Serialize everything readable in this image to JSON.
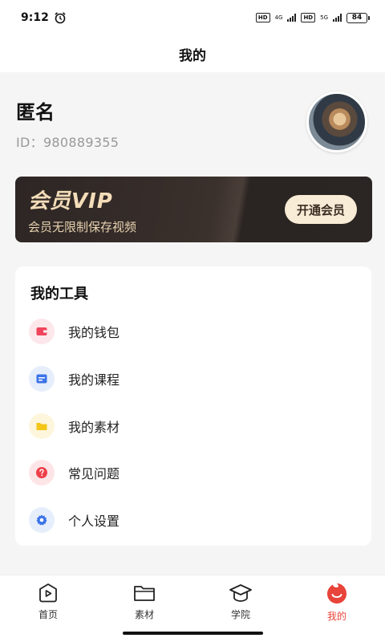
{
  "status": {
    "time": "9:12",
    "net1": "4G",
    "net2": "5G",
    "hd": "HD",
    "battery": "84"
  },
  "navbar": {
    "title": "我的"
  },
  "profile": {
    "name": "匿名",
    "id_text": "ID：980889355"
  },
  "vip": {
    "title": "会员VIP",
    "subtitle": "会员无限制保存视频",
    "button": "开通会员"
  },
  "tools": {
    "title": "我的工具",
    "items": [
      {
        "label": "我的钱包",
        "icon": "wallet-icon",
        "color": "#f0445c",
        "bg": "#fde7ea"
      },
      {
        "label": "我的课程",
        "icon": "course-icon",
        "color": "#3b73e8",
        "bg": "#e6eefc"
      },
      {
        "label": "我的素材",
        "icon": "folder-icon",
        "color": "#f5c518",
        "bg": "#fdf6dc"
      },
      {
        "label": "常见问题",
        "icon": "question-icon",
        "color": "#ef3f4a",
        "bg": "#fde5e7"
      },
      {
        "label": "个人设置",
        "icon": "settings-icon",
        "color": "#3b73e8",
        "bg": "#e6eefc"
      }
    ]
  },
  "tabbar": {
    "items": [
      {
        "label": "首页",
        "icon": "home-play-icon"
      },
      {
        "label": "素材",
        "icon": "folder-icon"
      },
      {
        "label": "学院",
        "icon": "graduation-cap-icon"
      },
      {
        "label": "我的",
        "icon": "profile-smile-icon",
        "active": true
      }
    ],
    "accent": "#e8443a"
  }
}
